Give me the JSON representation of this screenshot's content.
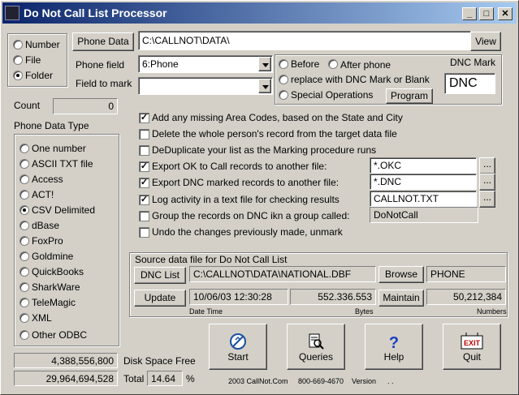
{
  "window": {
    "title": "Do Not Call List Processor",
    "min": "_",
    "max": "□",
    "close": "✕"
  },
  "source_type": {
    "options": [
      "Number",
      "File",
      "Folder"
    ],
    "selected": "Folder"
  },
  "phone_data": {
    "button": "Phone Data",
    "path": "C:\\CALLNOT\\DATA\\",
    "view": "View"
  },
  "phone_field": {
    "label": "Phone field",
    "value": "6:Phone"
  },
  "field_to_mark": {
    "label": "Field to mark",
    "value": ""
  },
  "mark_position": {
    "before": "Before",
    "after": "After phone",
    "replace": "replace with DNC Mark or Blank",
    "special": "Special Operations",
    "program": "Program"
  },
  "dnc_mark": {
    "label": "DNC Mark",
    "value": "DNC"
  },
  "count": {
    "label": "Count",
    "value": "0"
  },
  "phone_data_type": {
    "label": "Phone Data Type",
    "options": [
      "One number",
      "ASCII TXT file",
      "Access",
      "ACT!",
      "CSV Delimited",
      "dBase",
      "FoxPro",
      "Goldmine",
      "QuickBooks",
      "SharkWare",
      "TeleMagic",
      "XML",
      "Other ODBC"
    ],
    "selected": "CSV Delimited"
  },
  "options": [
    {
      "label": "Add any missing Area Codes, based on the State and City",
      "checked": true
    },
    {
      "label": "Delete the whole person's record from the target data file",
      "checked": false
    },
    {
      "label": "DeDuplicate your list as the Marking procedure runs",
      "checked": false
    },
    {
      "label": "Export OK to Call records to another file:",
      "checked": true,
      "value": "*.OKC"
    },
    {
      "label": "Export DNC marked records to another file:",
      "checked": true,
      "value": "*.DNC"
    },
    {
      "label": "Log activity in a text file for checking results",
      "checked": true,
      "value": "CALLNOT.TXT"
    },
    {
      "label": "Group the records on DNC ikn a group called:",
      "checked": false,
      "value": "DoNotCall"
    },
    {
      "label": "Undo the changes previously made, unmark",
      "checked": false
    }
  ],
  "source": {
    "title": "Source data file for Do Not Call List",
    "dnc_list_button": "DNC List",
    "path": "C:\\CALLNOT\\DATA\\NATIONAL.DBF",
    "browse": "Browse",
    "field": "PHONE",
    "update_button": "Update",
    "datetime": "10/06/03 12:30:28",
    "bytes": "552.336.553",
    "maintain": "Maintain",
    "numbers": "50,212,384",
    "datetime_label": "Date Time",
    "bytes_label": "Bytes",
    "numbers_label": "Numbers"
  },
  "disk": {
    "free": "4,388,556,800",
    "free_label": "Disk Space Free",
    "total": "29,964,694,528",
    "total_label": "Total",
    "pct": "14.64",
    "pct_sign": "%"
  },
  "actions": {
    "start": "Start",
    "queries": "Queries",
    "help": "Help",
    "quit": "Quit",
    "exit_sign": "EXIT"
  },
  "footer": {
    "copyright": "2003  CallNot.Com",
    "phone": "800-669-4670",
    "version_label": "Version",
    "version": ". ."
  }
}
